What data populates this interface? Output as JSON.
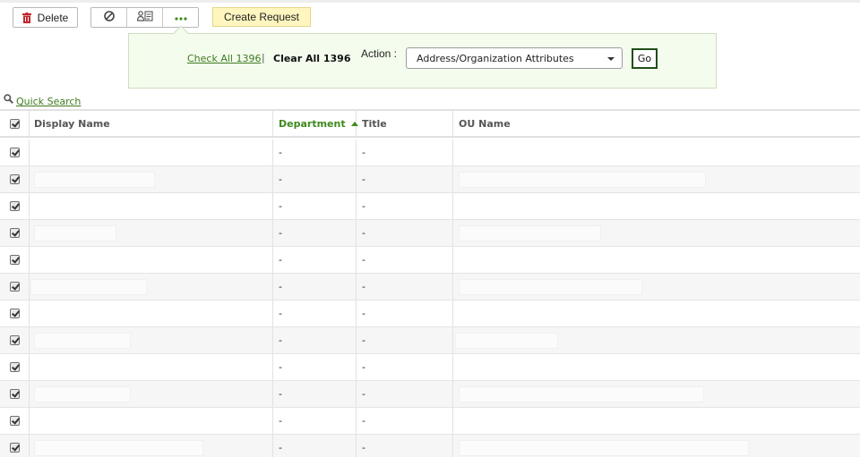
{
  "toolbar": {
    "delete_label": "Delete",
    "create_request_label": "Create Request"
  },
  "popover": {
    "check_all": "Check All 1396",
    "separator": "|",
    "clear_all": "Clear All 1396",
    "action_label": "Action :",
    "action_selected": "Address/Organization Attributes",
    "go_label": "Go"
  },
  "quick_search": {
    "label": "Quick Search"
  },
  "table": {
    "columns": [
      "Display Name",
      "Department",
      "Title",
      "OU Name"
    ],
    "sorted_column": "Department",
    "sort_direction": "ascending",
    "rows": [
      {
        "checked": true,
        "department": "-",
        "title": "-"
      },
      {
        "checked": true,
        "department": "-",
        "title": "-"
      },
      {
        "checked": true,
        "department": "-",
        "title": "-"
      },
      {
        "checked": true,
        "department": "-",
        "title": "-"
      },
      {
        "checked": true,
        "department": "-",
        "title": "-"
      },
      {
        "checked": true,
        "department": "-",
        "title": "-"
      },
      {
        "checked": true,
        "department": "-",
        "title": "-"
      },
      {
        "checked": true,
        "department": "-",
        "title": "-"
      },
      {
        "checked": true,
        "department": "-",
        "title": "-"
      },
      {
        "checked": true,
        "department": "-",
        "title": "-"
      },
      {
        "checked": true,
        "department": "-",
        "title": "-"
      },
      {
        "checked": true,
        "department": "-",
        "title": "-"
      }
    ]
  },
  "colors": {
    "accent_green": "#3f7a1e",
    "create_button_bg": "#fff6bf",
    "popover_bg": "#f4fcee",
    "delete_icon": "#c0262b"
  },
  "icons": [
    "trash-icon",
    "block-icon",
    "users-icon",
    "more-icon",
    "search-icon",
    "sort-ascending-icon",
    "chevron-down-icon"
  ]
}
